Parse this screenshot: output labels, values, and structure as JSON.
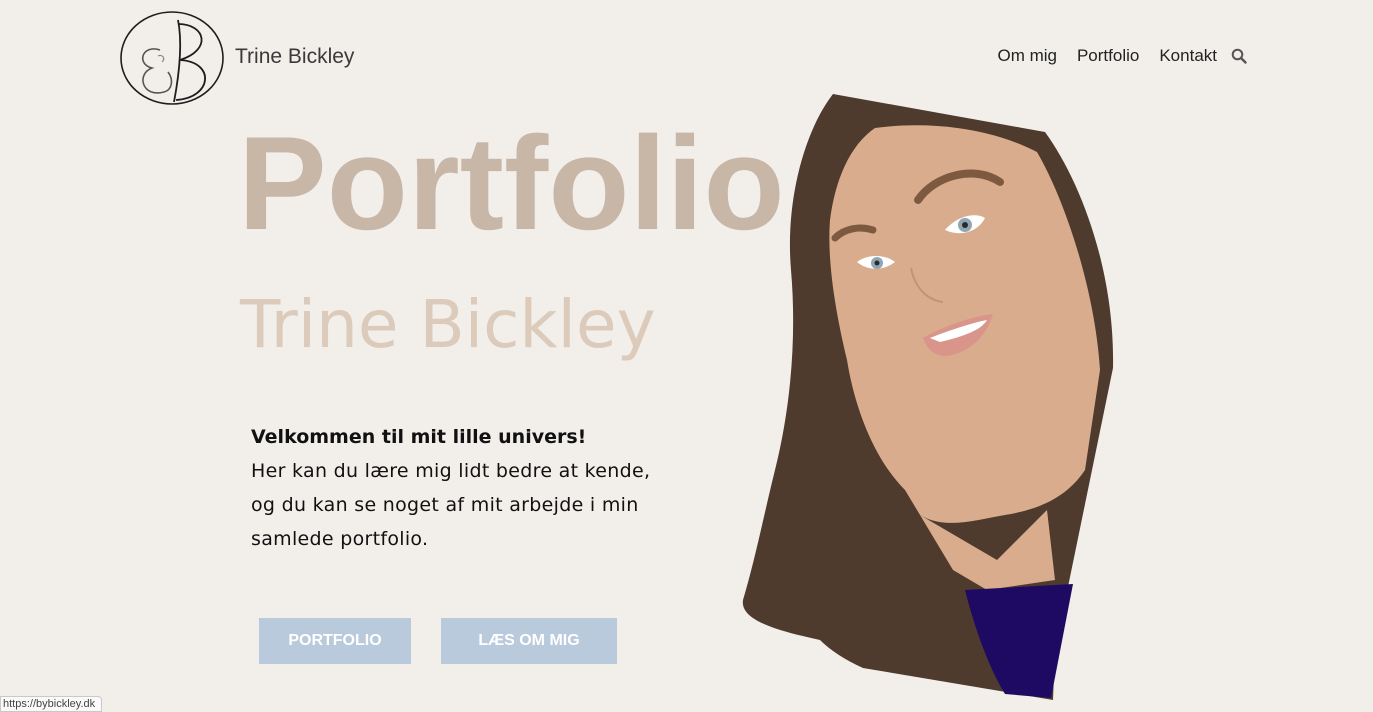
{
  "header": {
    "site_title": "Trine Bickley",
    "nav": [
      {
        "label": "Om mig"
      },
      {
        "label": "Portfolio"
      },
      {
        "label": "Kontakt"
      }
    ]
  },
  "hero": {
    "title": "Portfolio",
    "subtitle": "Trine Bickley",
    "intro_heading": "Velkommen til mit lille univers!",
    "intro_body": "Her kan du lære mig lidt bedre at kende, og du kan se noget af mit arbejde i min samlede portfolio."
  },
  "buttons": {
    "portfolio": "PORTFOLIO",
    "about": "LÆS OM MIG"
  },
  "status_bar": {
    "url": "https://bybickley.dk"
  },
  "colors": {
    "background": "#f2efeb",
    "title": "#c8b6a6",
    "button": "#b8cadc"
  }
}
